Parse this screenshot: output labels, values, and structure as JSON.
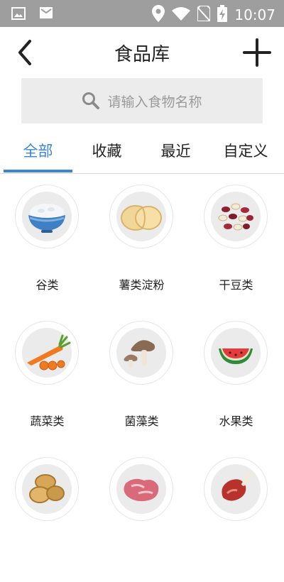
{
  "status_bar": {
    "time": "10:07",
    "icons": [
      "image-icon",
      "mail-icon",
      "location-icon",
      "wifi-icon",
      "no-sim-icon",
      "battery-charging-icon"
    ]
  },
  "nav": {
    "title": "食品库",
    "back_icon": "chevron-left-icon",
    "add_icon": "plus-icon"
  },
  "search": {
    "placeholder": "请输入食物名称",
    "icon": "search-icon"
  },
  "tabs": [
    {
      "label": "全部",
      "active": true
    },
    {
      "label": "收藏",
      "active": false
    },
    {
      "label": "最近",
      "active": false
    },
    {
      "label": "自定义",
      "active": false
    }
  ],
  "categories": [
    {
      "label": "谷类",
      "icon": "rice-bowl-icon"
    },
    {
      "label": "薯类淀粉",
      "icon": "potato-slices-icon"
    },
    {
      "label": "干豆类",
      "icon": "beans-icon"
    },
    {
      "label": "蔬菜类",
      "icon": "carrot-icon"
    },
    {
      "label": "菌藻类",
      "icon": "mushroom-icon"
    },
    {
      "label": "水果类",
      "icon": "watermelon-icon"
    },
    {
      "label": "",
      "icon": "nuts-icon"
    },
    {
      "label": "",
      "icon": "meat-icon"
    },
    {
      "label": "",
      "icon": "ham-leg-icon"
    }
  ],
  "colors": {
    "accent": "#3a86d4",
    "status_bar": "#9e9e9e",
    "search_bg": "#ececec"
  }
}
